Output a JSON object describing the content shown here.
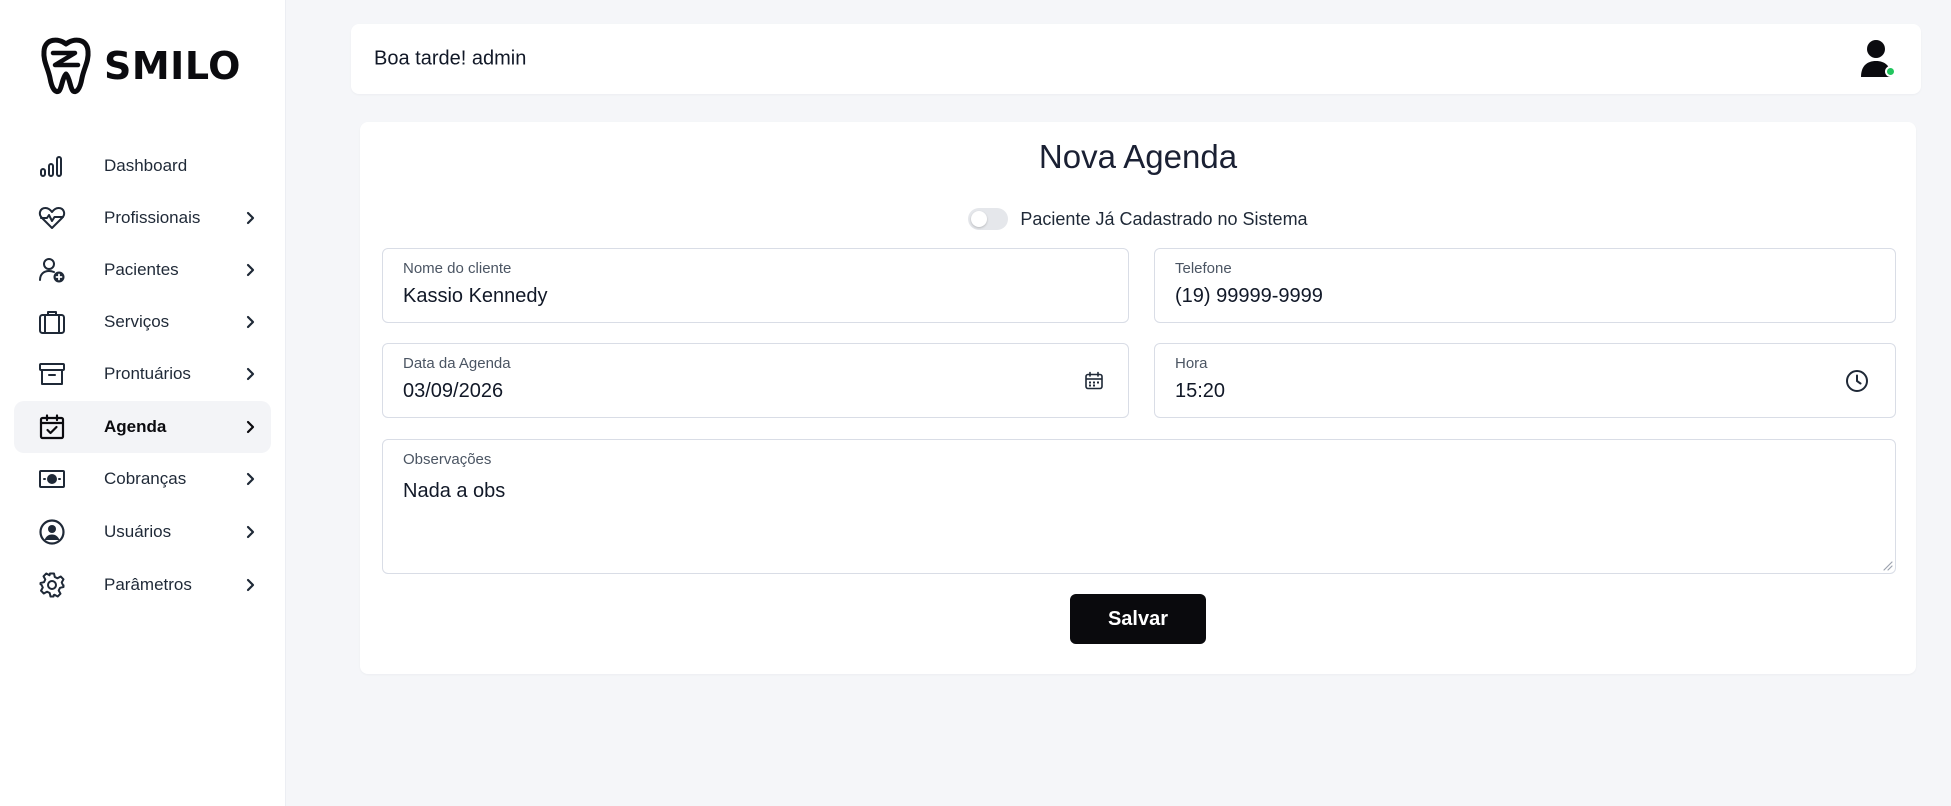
{
  "app": {
    "logo_text": "SMILO"
  },
  "sidebar": {
    "items": [
      {
        "label": "Dashboard",
        "icon": "bar-chart-icon",
        "has_chevron": false,
        "active": false
      },
      {
        "label": "Profissionais",
        "icon": "heart-pulse-icon",
        "has_chevron": true,
        "active": false
      },
      {
        "label": "Pacientes",
        "icon": "user-add-icon",
        "has_chevron": true,
        "active": false
      },
      {
        "label": "Serviços",
        "icon": "briefcase-icon",
        "has_chevron": true,
        "active": false
      },
      {
        "label": "Prontuários",
        "icon": "archive-box-icon",
        "has_chevron": true,
        "active": false
      },
      {
        "label": "Agenda",
        "icon": "calendar-check-icon",
        "has_chevron": true,
        "active": true
      },
      {
        "label": "Cobranças",
        "icon": "banknote-icon",
        "has_chevron": true,
        "active": false
      },
      {
        "label": "Usuários",
        "icon": "user-circle-icon",
        "has_chevron": true,
        "active": false
      },
      {
        "label": "Parâmetros",
        "icon": "gear-icon",
        "has_chevron": true,
        "active": false
      }
    ]
  },
  "header": {
    "greeting": "Boa tarde! admin",
    "status": "online"
  },
  "form": {
    "title": "Nova Agenda",
    "registered_toggle": {
      "label": "Paciente Já Cadastrado no Sistema",
      "checked": false
    },
    "client_name": {
      "label": "Nome do cliente",
      "value": "Kassio Kennedy"
    },
    "phone": {
      "label": "Telefone",
      "value": "(19) 99999-9999"
    },
    "date": {
      "label": "Data da Agenda",
      "value": "03/09/2026"
    },
    "time": {
      "label": "Hora",
      "value": "15:20"
    },
    "notes": {
      "label": "Observações",
      "value": "Nada a obs"
    },
    "save_label": "Salvar"
  },
  "colors": {
    "page_background": "#f5f6f9",
    "primary_button": "#0a0a0d",
    "online_indicator": "#22c55e",
    "active_nav_background": "#f3f4f7"
  }
}
